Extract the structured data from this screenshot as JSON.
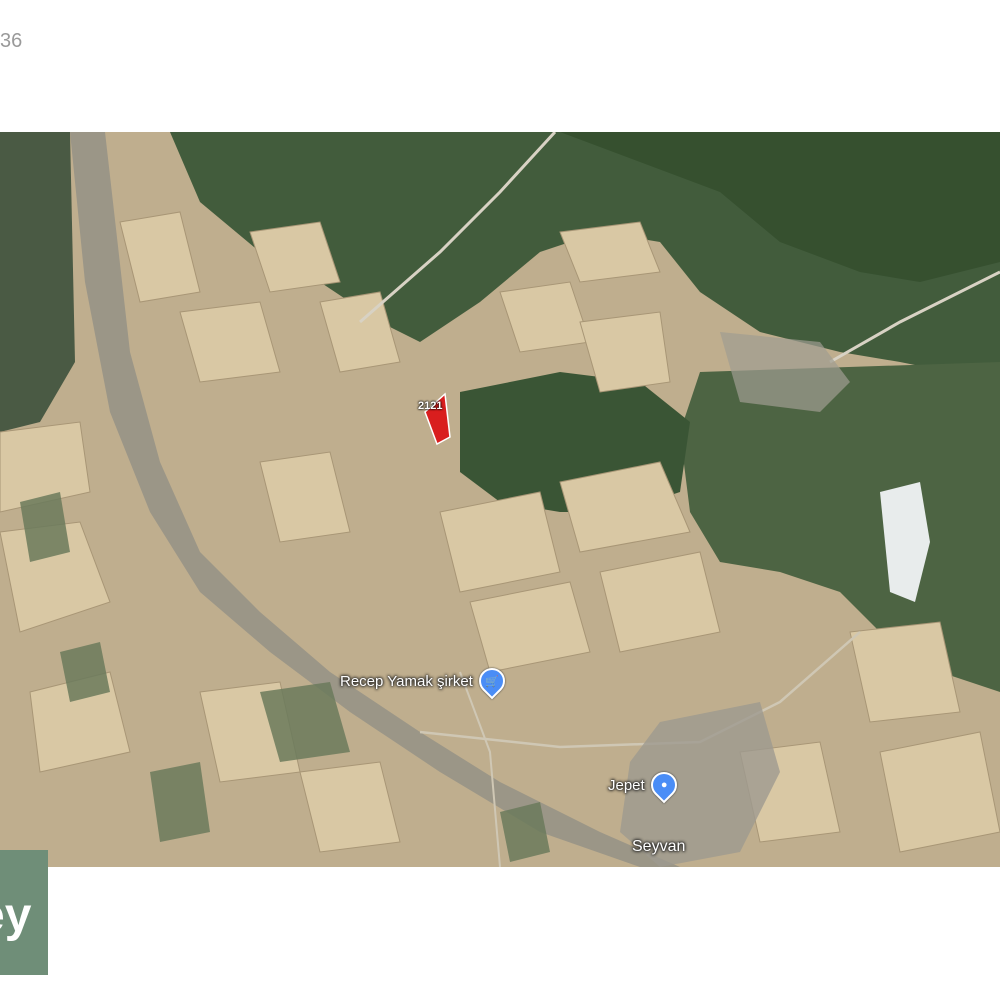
{
  "header": {
    "corner_text": "36"
  },
  "map": {
    "parcel_label": "2121",
    "places": {
      "store": {
        "label": "Recep Yamak şirket",
        "icon": "shopping-cart-icon"
      },
      "village": {
        "label": "Jepet",
        "icon": "map-pin-icon"
      },
      "town": {
        "label": "Seyvan"
      }
    },
    "colors": {
      "parcel_outline": "#d91e1e",
      "forest": "#3f5a3a",
      "field": "#c9b48f",
      "poi_pin": "#4a8df6"
    }
  },
  "watermark": {
    "logo_text": "ey",
    "color": "#6f8e78"
  }
}
